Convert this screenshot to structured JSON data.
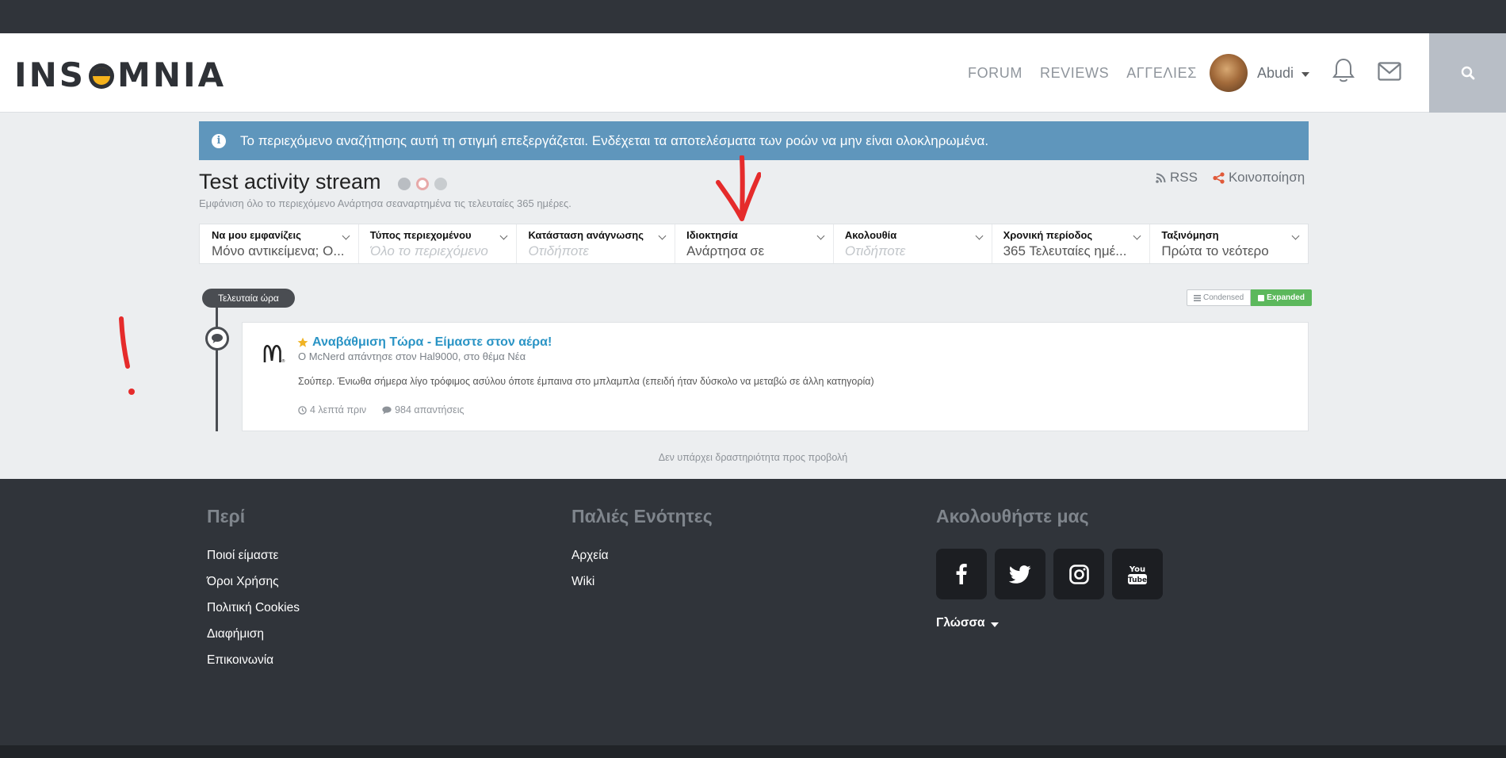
{
  "header": {
    "logo_text_left": "INS",
    "logo_text_right": "MNIA",
    "nav": [
      {
        "label": "FORUM"
      },
      {
        "label": "REVIEWS"
      },
      {
        "label": "ΑΓΓΕΛΙΕΣ"
      }
    ],
    "user": {
      "name": "Abudi"
    },
    "icons": {
      "notifications": "bell-icon",
      "messages": "envelope-icon",
      "search": "search-icon"
    }
  },
  "alert": {
    "text": "Το περιεχόμενο αναζήτησης αυτή τη στιγμή επεξεργάζεται. Ενδέχεται τα αποτελέσματα των ροών να μην είναι ολοκληρωμένα.",
    "icon": "info-icon"
  },
  "page": {
    "title": "Test activity stream",
    "description": "Εμφάνιση όλο το περιεχόμενο Ανάρτησα σεαναρτημένα τις τελευταίες 365 ημέρες.",
    "rss_label": "RSS",
    "share_label": "Κοινοποίηση"
  },
  "filters": [
    {
      "label": "Να μου εμφανίζεις",
      "value": "Μόνο αντικείμενα; Ο...",
      "placeholder": false
    },
    {
      "label": "Τύπος περιεχομένου",
      "value": "Όλο το περιεχόμενο",
      "placeholder": true
    },
    {
      "label": "Κατάσταση ανάγνωσης",
      "value": "Οτιδήποτε",
      "placeholder": true
    },
    {
      "label": "Ιδιοκτησία",
      "value": "Ανάρτησα σε",
      "placeholder": false
    },
    {
      "label": "Ακολουθία",
      "value": "Οτιδήποτε",
      "placeholder": true
    },
    {
      "label": "Χρονική περίοδος",
      "value": "365 Τελευταίες ημέ...",
      "placeholder": false
    },
    {
      "label": "Ταξινόμηση",
      "value": "Πρώτα το νεότερο",
      "placeholder": false
    }
  ],
  "timeline": {
    "group_label": "Τελευταία ώρα",
    "view_condensed": "Condensed",
    "view_expanded": "Expanded",
    "active_view": "Expanded"
  },
  "stream": [
    {
      "title": "Αναβάθμιση Τώρα - Είμαστε στον αέρα!",
      "meta": "Ο McNerd απάντησε στον Hal9000, στο θέμα Νέα",
      "body": "Σούπερ. Ένιωθα σήμερα λίγο τρόφιμος ασύλου όποτε έμπαινα στο μπλαμπλα (επειδή ήταν δύσκολο να μεταβώ σε άλλη κατηγορία)",
      "time": "4 λεπτά πριν",
      "replies": "984 απαντήσεις",
      "featured": true
    }
  ],
  "no_more_text": "Δεν υπάρχει δραστηριότητα προς προβολή",
  "footer": {
    "about": {
      "heading": "Περί",
      "links": [
        "Ποιοί είμαστε",
        "Όροι Χρήσης",
        "Πολιτική Cookies",
        "Διαφήμιση",
        "Επικοινωνία"
      ]
    },
    "old": {
      "heading": "Παλιές Ενότητες",
      "links": [
        "Αρχεία",
        "Wiki"
      ]
    },
    "follow": {
      "heading": "Ακολουθήστε μας",
      "social": [
        "facebook-icon",
        "twitter-icon",
        "instagram-icon",
        "youtube-icon"
      ],
      "youtube_top": "You",
      "youtube_bottom": "Tube",
      "language_label": "Γλώσσα"
    }
  },
  "colors": {
    "alert_bg": "#5f96bc",
    "link_blue": "#2a94c5",
    "expanded_green": "#5cb85c",
    "dark_bar": "#30343a",
    "annotation_red": "#e52b2b"
  }
}
